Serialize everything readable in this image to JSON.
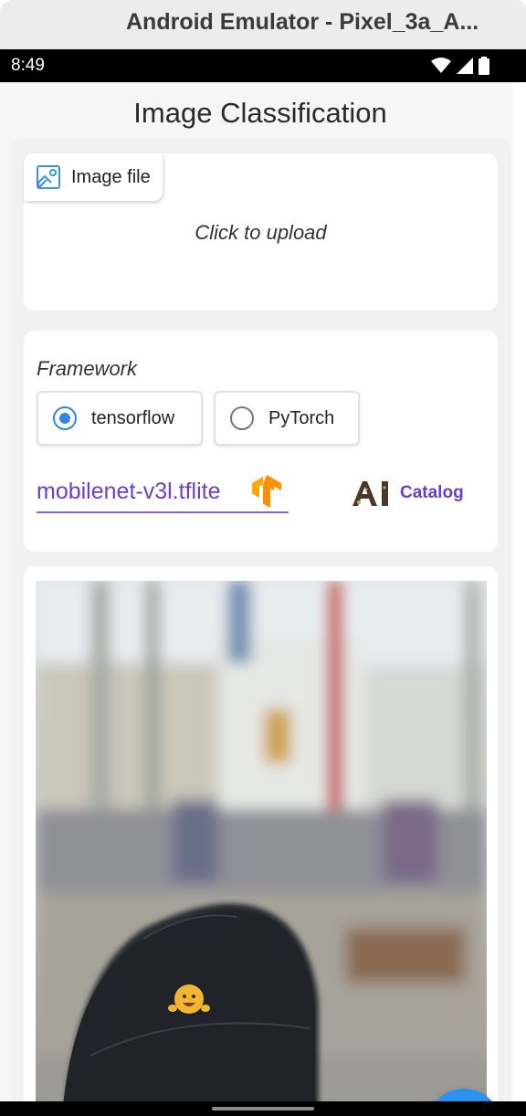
{
  "window": {
    "title": "Android Emulator - Pixel_3a_A..."
  },
  "status_bar": {
    "time": "8:49"
  },
  "app": {
    "title": "Image Classification",
    "upload": {
      "chip_label": "Image file",
      "hint": "Click to upload"
    },
    "framework": {
      "label": "Framework",
      "options": [
        {
          "label": "tensorflow",
          "selected": true
        },
        {
          "label": "PyTorch",
          "selected": false
        }
      ],
      "model_value": "mobilenet-v3l.tflite",
      "catalog_label": "Catalog"
    },
    "fab": {
      "icon": "arrow-back-icon"
    }
  },
  "colors": {
    "accent_purple": "#6b3fc7",
    "radio_blue": "#2f86e8",
    "fab_blue": "#2b92ee"
  }
}
